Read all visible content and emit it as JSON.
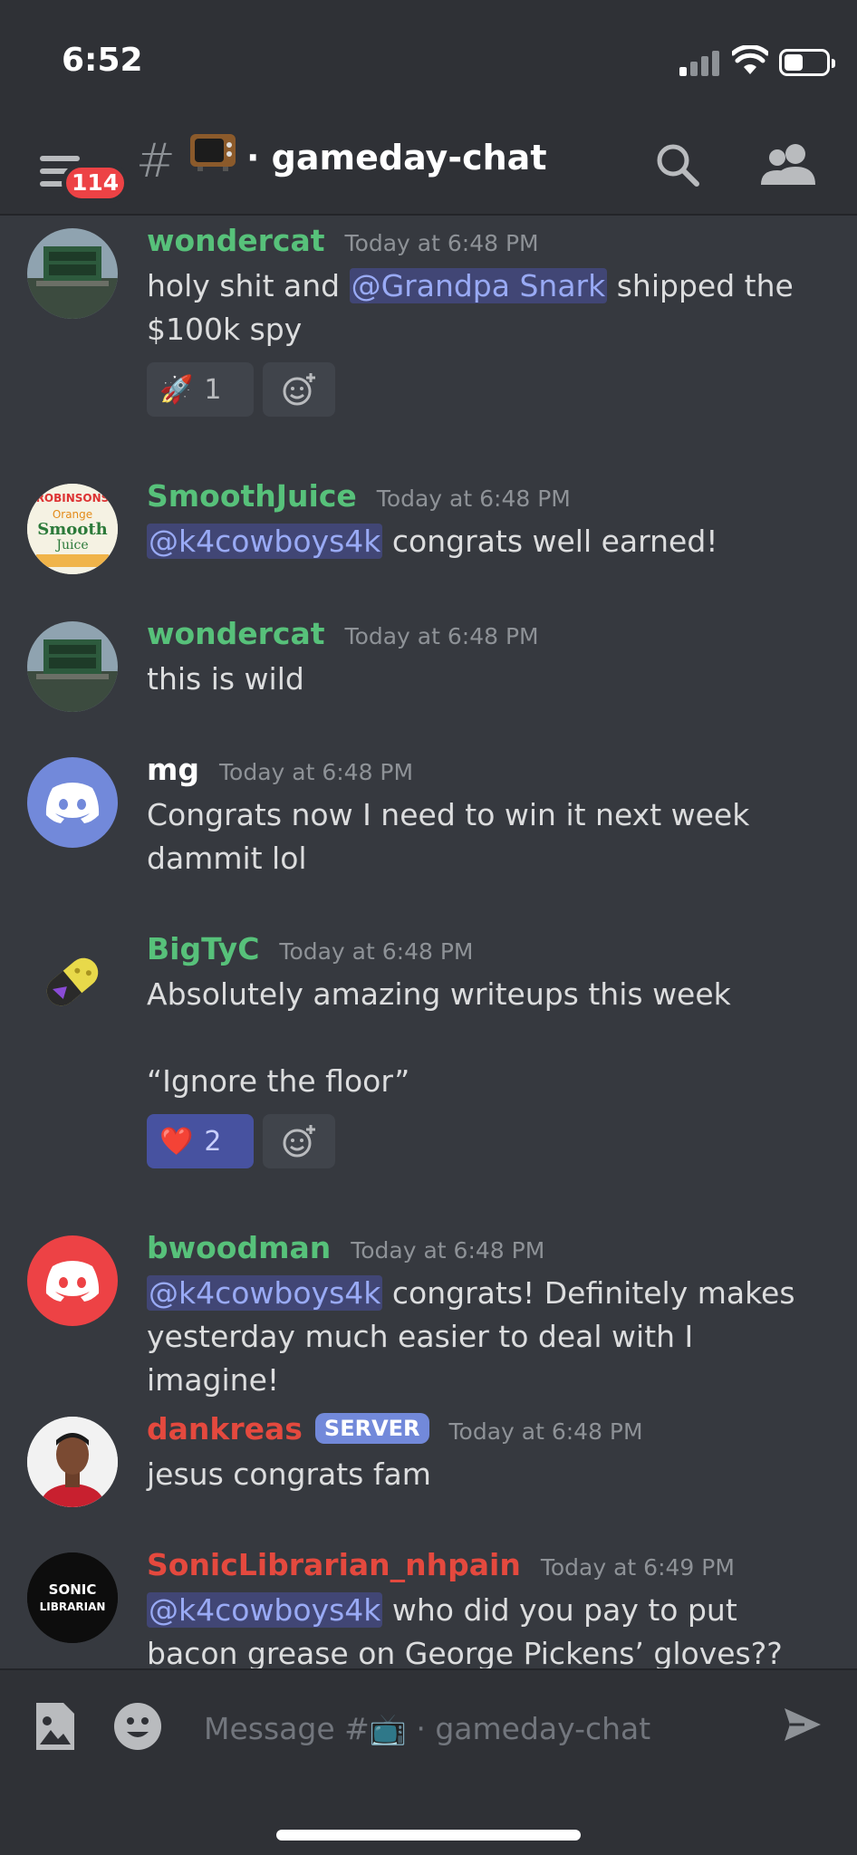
{
  "status_bar": {
    "time": "6:52"
  },
  "header": {
    "badge_count": "114",
    "channel_emoji": "📺",
    "channel_name": "· gameday-chat"
  },
  "colors": {
    "green_user": "#57c17a",
    "red_user": "#e4493e",
    "mention_bg": "#414675",
    "blurple": "#7289da"
  },
  "messages": [
    {
      "username": "wondercat",
      "timestamp": "Today at 6:48 PM",
      "text_before": "holy shit and ",
      "mention": "@Grandpa Snark",
      "text_after": " shipped the $100k spy",
      "reactions": [
        {
          "emoji": "🚀",
          "count": "1"
        }
      ]
    },
    {
      "username": "SmoothJuice",
      "timestamp": "Today at 6:48 PM",
      "mention": "@k4cowboys4k",
      "text_after": " congrats well earned!"
    },
    {
      "username": "wondercat",
      "timestamp": "Today at 6:48 PM",
      "text": "this is wild"
    },
    {
      "username": "mg",
      "timestamp": "Today at 6:48 PM",
      "text": "Congrats now I need to win it next week dammit lol"
    },
    {
      "username": "BigTyC",
      "timestamp": "Today at 6:48 PM",
      "text_line1": "Absolutely amazing writeups this week",
      "text_line2": "“Ignore the floor”",
      "reactions": [
        {
          "emoji": "❤️",
          "count": "2"
        }
      ]
    },
    {
      "username": "bwoodman",
      "timestamp": "Today at 6:48 PM",
      "mention": "@k4cowboys4k",
      "text_after": " congrats! Definitely makes yesterday much easier to deal with I imagine!"
    },
    {
      "username": "dankreas",
      "tag": "SERVER",
      "timestamp": "Today at 6:48 PM",
      "text": "jesus congrats fam"
    },
    {
      "username": "SonicLibrarian_nhpain",
      "timestamp": "Today at 6:49 PM",
      "mention": "@k4cowboys4k",
      "text_after": " who did you pay to put bacon grease on George Pickens’ gloves??",
      "avatar_text_line1": "SONIC",
      "avatar_text_line2": "LIBRARIAN"
    }
  ],
  "smoothjuice_avatar": {
    "brand": "ROBINSONS",
    "flavor": "Orange",
    "line1": "Smooth",
    "line2": "Juice"
  },
  "composer": {
    "placeholder": "Message #📺 · gameday-chat"
  }
}
